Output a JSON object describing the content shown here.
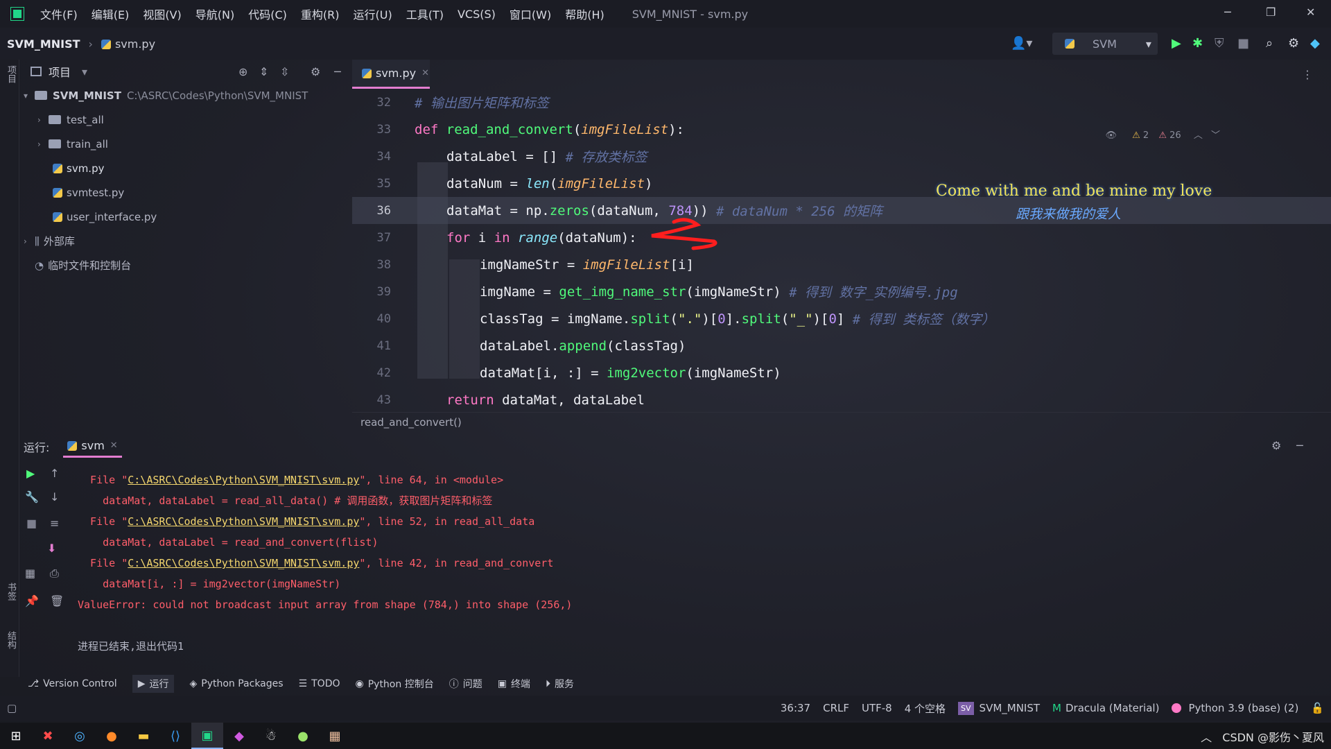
{
  "titlebar": {
    "menus": [
      "文件(F)",
      "编辑(E)",
      "视图(V)",
      "导航(N)",
      "代码(C)",
      "重构(R)",
      "运行(U)",
      "工具(T)",
      "VCS(S)",
      "窗口(W)",
      "帮助(H)"
    ],
    "window_title": "SVM_MNIST - svm.py",
    "logo_text": "PC"
  },
  "navbar": {
    "project": "SVM_MNIST",
    "file": "svm.py",
    "run_config": "SVM"
  },
  "left_strip": {
    "project_label": "项目",
    "bookmarks_label": "书签",
    "structure_label": "结构"
  },
  "project_panel": {
    "title": "项目",
    "root_name": "SVM_MNIST",
    "root_path": "C:\\ASRC\\Codes\\Python\\SVM_MNIST",
    "items": [
      {
        "name": "test_all",
        "kind": "folder"
      },
      {
        "name": "train_all",
        "kind": "folder"
      },
      {
        "name": "svm.py",
        "kind": "file"
      },
      {
        "name": "svmtest.py",
        "kind": "file"
      },
      {
        "name": "user_interface.py",
        "kind": "file"
      }
    ],
    "external_libs": "外部库",
    "scratches": "临时文件和控制台"
  },
  "editor": {
    "tab": "svm.py",
    "inspections": {
      "warnings": "2",
      "weak_warnings": "26"
    },
    "lines": [
      {
        "num": "32",
        "comment": "# 输出图片矩阵和标签"
      },
      {
        "num": "33",
        "kw": "def",
        "fn": "read_and_convert",
        "param": "imgFileList"
      },
      {
        "num": "34",
        "code": "dataLabel = [] ",
        "comment": "# 存放类标签"
      },
      {
        "num": "35",
        "code_a": "dataNum = ",
        "builtin": "len",
        "param": "imgFileList"
      },
      {
        "num": "36",
        "code_a": "dataMat = np.",
        "fn": "zeros",
        "code_b": "(dataNum, ",
        "num_lit": "784",
        "comment": "# dataNum * 256 的矩阵"
      },
      {
        "num": "37",
        "kw": "for",
        "code_a": " i ",
        "kw2": "in",
        "builtin": "range",
        "code_b": "(dataNum):"
      },
      {
        "num": "38",
        "code_a": "imgNameStr = ",
        "param": "imgFileList",
        "code_b": "[i]"
      },
      {
        "num": "39",
        "code_a": "imgName = ",
        "fn": "get_img_name_str",
        "code_b": "(imgNameStr)",
        "comment": "# 得到 数字_实例编号.jpg"
      },
      {
        "num": "40",
        "code_a": "classTag = imgName.",
        "fn": "split",
        "str1": "\".\"",
        "idx": "0",
        "fn2": "split",
        "str2": "\"_\"",
        "idx2": "0",
        "comment": "# 得到 类标签（数字）"
      },
      {
        "num": "41",
        "code_a": "dataLabel.",
        "fn": "append",
        "code_b": "(classTag)"
      },
      {
        "num": "42",
        "code_a": "dataMat[i, :] = ",
        "fn": "img2vector",
        "code_b": "(imgNameStr)"
      },
      {
        "num": "43",
        "kw": "return",
        "code_b": " dataMat, dataLabel"
      }
    ],
    "breadcrumb": "read_and_convert()"
  },
  "lyrics": {
    "line1": "Come with me and be mine my love",
    "line2": "跟我来做我的爱人"
  },
  "run_panel": {
    "label": "运行:",
    "tab": "svm",
    "console": [
      {
        "type": "file",
        "pre": "  File \"",
        "link": "C:\\ASRC\\Codes\\Python\\SVM_MNIST\\svm.py",
        "post": "\", line 64, in <module>"
      },
      {
        "type": "err",
        "text": "    dataMat, dataLabel = read_all_data() # 调用函数，获取图片矩阵和标签"
      },
      {
        "type": "file",
        "pre": "  File \"",
        "link": "C:\\ASRC\\Codes\\Python\\SVM_MNIST\\svm.py",
        "post": "\", line 52, in read_all_data"
      },
      {
        "type": "err",
        "text": "    dataMat, dataLabel = read_and_convert(flist)"
      },
      {
        "type": "file",
        "pre": "  File \"",
        "link": "C:\\ASRC\\Codes\\Python\\SVM_MNIST\\svm.py",
        "post": "\", line 42, in read_and_convert"
      },
      {
        "type": "err",
        "text": "    dataMat[i, :] = img2vector(imgNameStr)"
      },
      {
        "type": "err",
        "text": "ValueError: could not broadcast input array from shape (784,) into shape (256,)"
      },
      {
        "type": "plain",
        "text": " "
      },
      {
        "type": "plain",
        "text": "进程已结束,退出代码1"
      }
    ]
  },
  "tool_tabs": [
    "Version Control",
    "运行",
    "Python Packages",
    "TODO",
    "Python 控制台",
    "问题",
    "终端",
    "服务"
  ],
  "statusbar": {
    "position": "36:37",
    "line_sep": "CRLF",
    "encoding": "UTF-8",
    "indent": "4 个空格",
    "project_badge": "SV",
    "project": "SVM_MNIST",
    "theme": "Dracula (Material)",
    "interpreter": "Python 3.9 (base) (2)"
  },
  "taskbar": {
    "tray_text": "CSDN @影伤丶夏风"
  },
  "colors": {
    "accent": "#e37dd0",
    "keyword": "#ff79c6",
    "function": "#50fa7b",
    "error": "#ff5e6a",
    "comment": "#6272a4"
  }
}
